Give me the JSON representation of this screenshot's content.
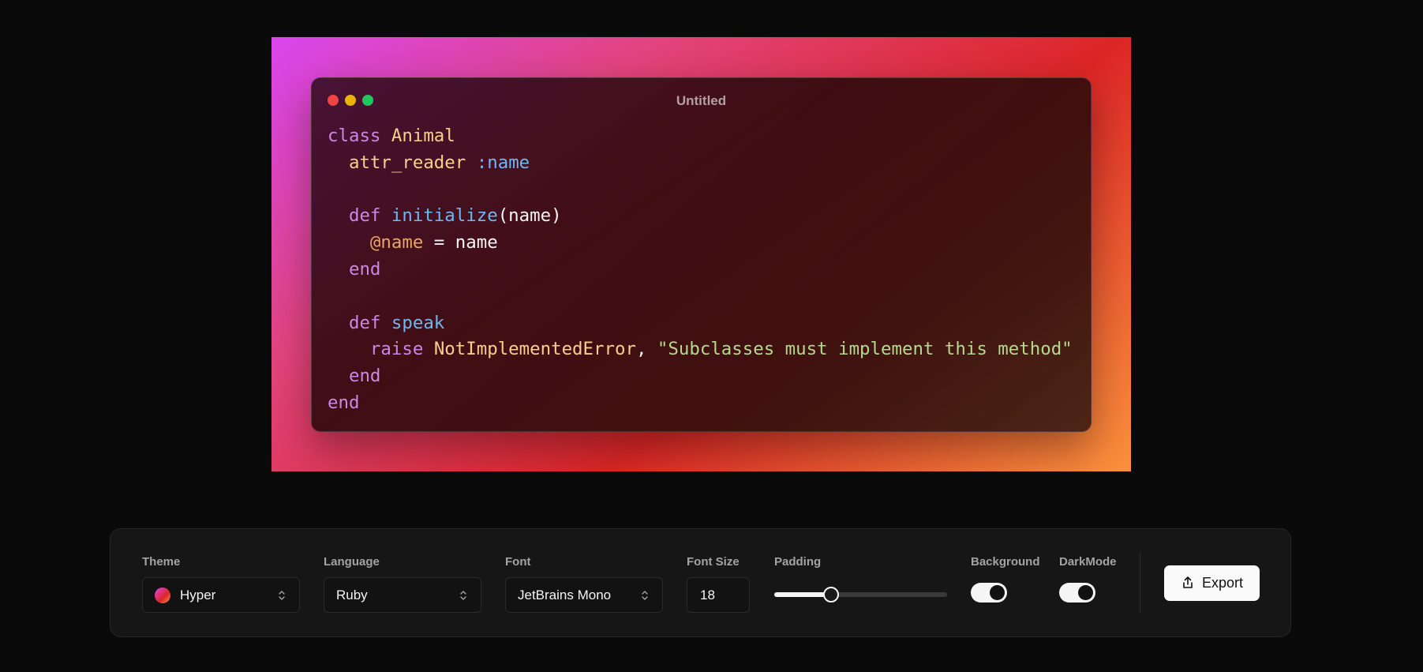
{
  "window": {
    "title": "Untitled"
  },
  "code": {
    "language": "Ruby",
    "lines": [
      [
        {
          "t": "class ",
          "k": "kw"
        },
        {
          "t": "Animal",
          "k": "cls"
        }
      ],
      [
        {
          "t": "  ",
          "k": "plain"
        },
        {
          "t": "attr_reader",
          "k": "cls"
        },
        {
          "t": " ",
          "k": "plain"
        },
        {
          "t": ":name",
          "k": "sym"
        }
      ],
      [],
      [
        {
          "t": "  ",
          "k": "plain"
        },
        {
          "t": "def ",
          "k": "kw"
        },
        {
          "t": "initialize",
          "k": "fn"
        },
        {
          "t": "(name)",
          "k": "plain"
        }
      ],
      [
        {
          "t": "    ",
          "k": "plain"
        },
        {
          "t": "@name",
          "k": "ivar"
        },
        {
          "t": " = name",
          "k": "plain"
        }
      ],
      [
        {
          "t": "  ",
          "k": "plain"
        },
        {
          "t": "end",
          "k": "kw"
        }
      ],
      [],
      [
        {
          "t": "  ",
          "k": "plain"
        },
        {
          "t": "def ",
          "k": "kw"
        },
        {
          "t": "speak",
          "k": "fn"
        }
      ],
      [
        {
          "t": "    ",
          "k": "plain"
        },
        {
          "t": "raise ",
          "k": "kw"
        },
        {
          "t": "NotImplementedError",
          "k": "cls"
        },
        {
          "t": ", ",
          "k": "plain"
        },
        {
          "t": "\"Subclasses must implement this method\"",
          "k": "str"
        }
      ],
      [
        {
          "t": "  ",
          "k": "plain"
        },
        {
          "t": "end",
          "k": "kw"
        }
      ],
      [
        {
          "t": "end",
          "k": "kw"
        }
      ]
    ]
  },
  "colors": {
    "gradient_start": "#d946ef",
    "gradient_mid": "#dc2626",
    "gradient_end": "#fb923c",
    "keyword": "#cd86e3",
    "class_name": "#f9cf8f",
    "symbol": "#6fb7f2",
    "string": "#b6d88f"
  },
  "toolbar": {
    "theme": {
      "label": "Theme",
      "value": "Hyper"
    },
    "language": {
      "label": "Language",
      "value": "Ruby"
    },
    "font": {
      "label": "Font",
      "value": "JetBrains Mono"
    },
    "font_size": {
      "label": "Font Size",
      "value": "18"
    },
    "padding": {
      "label": "Padding",
      "level_fraction": 0.33
    },
    "background": {
      "label": "Background",
      "on": true
    },
    "darkmode": {
      "label": "DarkMode",
      "on": true
    },
    "export_label": "Export"
  },
  "icons": {
    "select_chevron": "chevrons-up-down-icon",
    "export": "share-export-icon"
  }
}
